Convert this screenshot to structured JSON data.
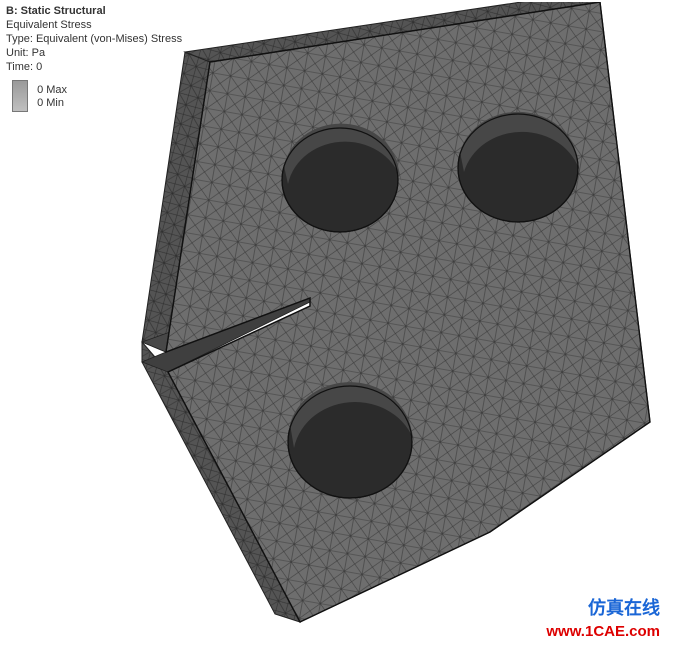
{
  "header": {
    "title": "B: Static Structural",
    "result_name": "Equivalent Stress",
    "result_type": "Type: Equivalent (von-Mises) Stress",
    "unit": "Unit: Pa",
    "time": "Time: 0"
  },
  "legend": {
    "max_label": "0 Max",
    "min_label": "0 Min"
  },
  "watermark": {
    "cn": "仿真在线",
    "url": "www.1CAE.com"
  },
  "model": {
    "description": "Flat plate with slot and three through-holes, tetrahedral mesh displayed",
    "color": "#6e6e6e",
    "mesh_edge": "#3a3a3a"
  }
}
